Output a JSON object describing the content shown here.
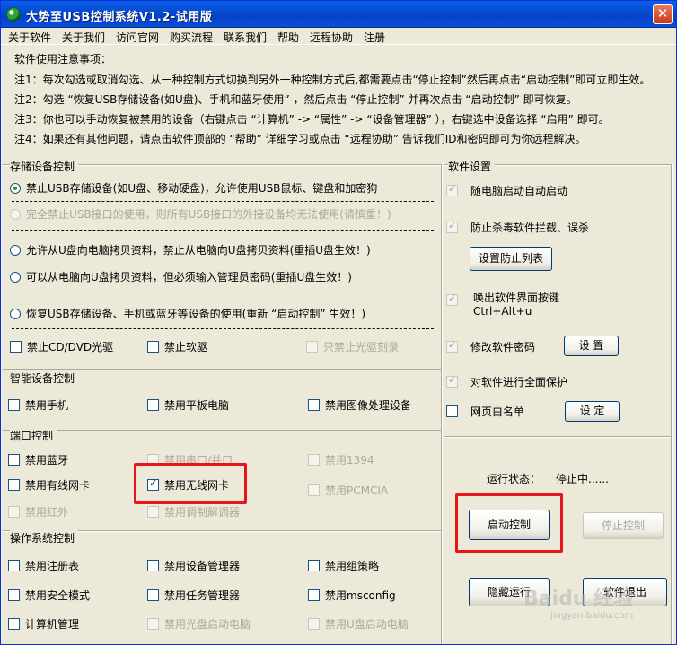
{
  "window": {
    "title": "大势至USB控制系统V1.2-试用版",
    "close_label": "✕"
  },
  "menu": [
    "关于软件",
    "关于我们",
    "访问官网",
    "购买流程",
    "联系我们",
    "帮助",
    "远程协助",
    "注册"
  ],
  "notes": {
    "heading": "软件使用注意事项：",
    "lines": [
      "注1：每次勾选或取消勾选、从一种控制方式切换到另外一种控制方式后,都需要点击“停止控制”然后再点击“启动控制”即可立即生效。",
      "注2：勾选 “恢复USB存储设备(如U盘)、手机和蓝牙使用” ，然后点击 “停止控制” 并再次点击 “启动控制” 即可恢复。",
      "注3：你也可以手动恢复被禁用的设备（右键点击 “计算机” -> “属性” -> “设备管理器” ），右键选中设备选择 “启用” 即可。",
      "注4：如果还有其他问题，请点击软件顶部的 “帮助” 详细学习或点击 “远程协助” 告诉我们ID和密码即可为你远程解决。"
    ]
  },
  "storage": {
    "title": "存储设备控制",
    "radios": [
      {
        "label": "禁止USB存储设备(如U盘、移动硬盘)，允许使用USB鼠标、键盘和加密狗",
        "checked": true,
        "disabled": false
      },
      {
        "label": "完全禁止USB接口的使用，则所有USB接口的外接设备均无法使用(请慎重！)",
        "checked": false,
        "disabled": true
      },
      {
        "label": "允许从U盘向电脑拷贝资料，禁止从电脑向U盘拷贝资料(重插U盘生效！)",
        "checked": false,
        "disabled": false
      },
      {
        "label": "可以从电脑向U盘拷贝资料，但必须输入管理员密码(重插U盘生效！)",
        "checked": false,
        "disabled": false
      },
      {
        "label": "恢复USB存储设备、手机或蓝牙等设备的使用(重新 “启动控制” 生效！)",
        "checked": false,
        "disabled": false
      }
    ],
    "checks": [
      {
        "label": "禁止CD/DVD光驱",
        "checked": false,
        "disabled": false
      },
      {
        "label": "禁止软驱",
        "checked": false,
        "disabled": false
      },
      {
        "label": "只禁止光驱刻录",
        "checked": false,
        "disabled": true
      }
    ]
  },
  "smart": {
    "title": "智能设备控制",
    "checks": [
      {
        "label": "禁用手机",
        "checked": false,
        "disabled": false
      },
      {
        "label": "禁用平板电脑",
        "checked": false,
        "disabled": false
      },
      {
        "label": "禁用图像处理设备",
        "checked": false,
        "disabled": false
      }
    ]
  },
  "port": {
    "title": "端口控制",
    "checks": [
      {
        "label": "禁用蓝牙",
        "checked": false,
        "disabled": false
      },
      {
        "label": "禁用串口/并口",
        "checked": false,
        "disabled": true
      },
      {
        "label": "禁用1394",
        "checked": false,
        "disabled": true
      },
      {
        "label": "禁用有线网卡",
        "checked": false,
        "disabled": false
      },
      {
        "label": "禁用无线网卡",
        "checked": true,
        "disabled": false
      },
      {
        "label": "禁用PCMCIA",
        "checked": false,
        "disabled": true
      },
      {
        "label": "禁用红外",
        "checked": false,
        "disabled": true
      },
      {
        "label": "禁用调制解调器",
        "checked": false,
        "disabled": true
      }
    ]
  },
  "os": {
    "title": "操作系统控制",
    "checks": [
      {
        "label": "禁用注册表",
        "checked": false,
        "disabled": false
      },
      {
        "label": "禁用设备管理器",
        "checked": false,
        "disabled": false
      },
      {
        "label": "禁用组策略",
        "checked": false,
        "disabled": false
      },
      {
        "label": "禁用安全模式",
        "checked": false,
        "disabled": false
      },
      {
        "label": "禁用任务管理器",
        "checked": false,
        "disabled": false
      },
      {
        "label": "禁用msconfig",
        "checked": false,
        "disabled": false
      },
      {
        "label": "计算机管理",
        "checked": false,
        "disabled": false
      },
      {
        "label": "禁用光盘启动电脑",
        "checked": false,
        "disabled": true
      },
      {
        "label": "禁用U盘启动电脑",
        "checked": false,
        "disabled": true
      }
    ]
  },
  "settings": {
    "title": "软件设置",
    "autostart": {
      "label": "随电脑启动自动启动",
      "checked": true,
      "disabled": true
    },
    "antivirus": {
      "label": "防止杀毒软件拦截、误杀",
      "checked": true,
      "disabled": true
    },
    "whitelist_button": "设置防止列表",
    "hotkey": {
      "label_line1": "唤出软件界面按键",
      "label_line2": "Ctrl+Alt+u",
      "checked": true,
      "disabled": true
    },
    "password": {
      "label": "修改软件密码",
      "checked": true,
      "disabled": true
    },
    "password_button": "设 置",
    "protect": {
      "label": "对软件进行全面保护",
      "checked": true,
      "disabled": true
    },
    "webwhitelist": {
      "label": "网页白名单",
      "checked": false,
      "disabled": false
    },
    "web_button": "设 定"
  },
  "control": {
    "status_label": "运行状态：",
    "status_value": "停止中......",
    "start_button": "启动控制",
    "stop_button": "停止控制",
    "hide_button": "隐藏运行",
    "exit_button": "软件退出"
  },
  "watermark": {
    "main": "Baidu 经验",
    "sub": "jingyan.baidu.com"
  }
}
